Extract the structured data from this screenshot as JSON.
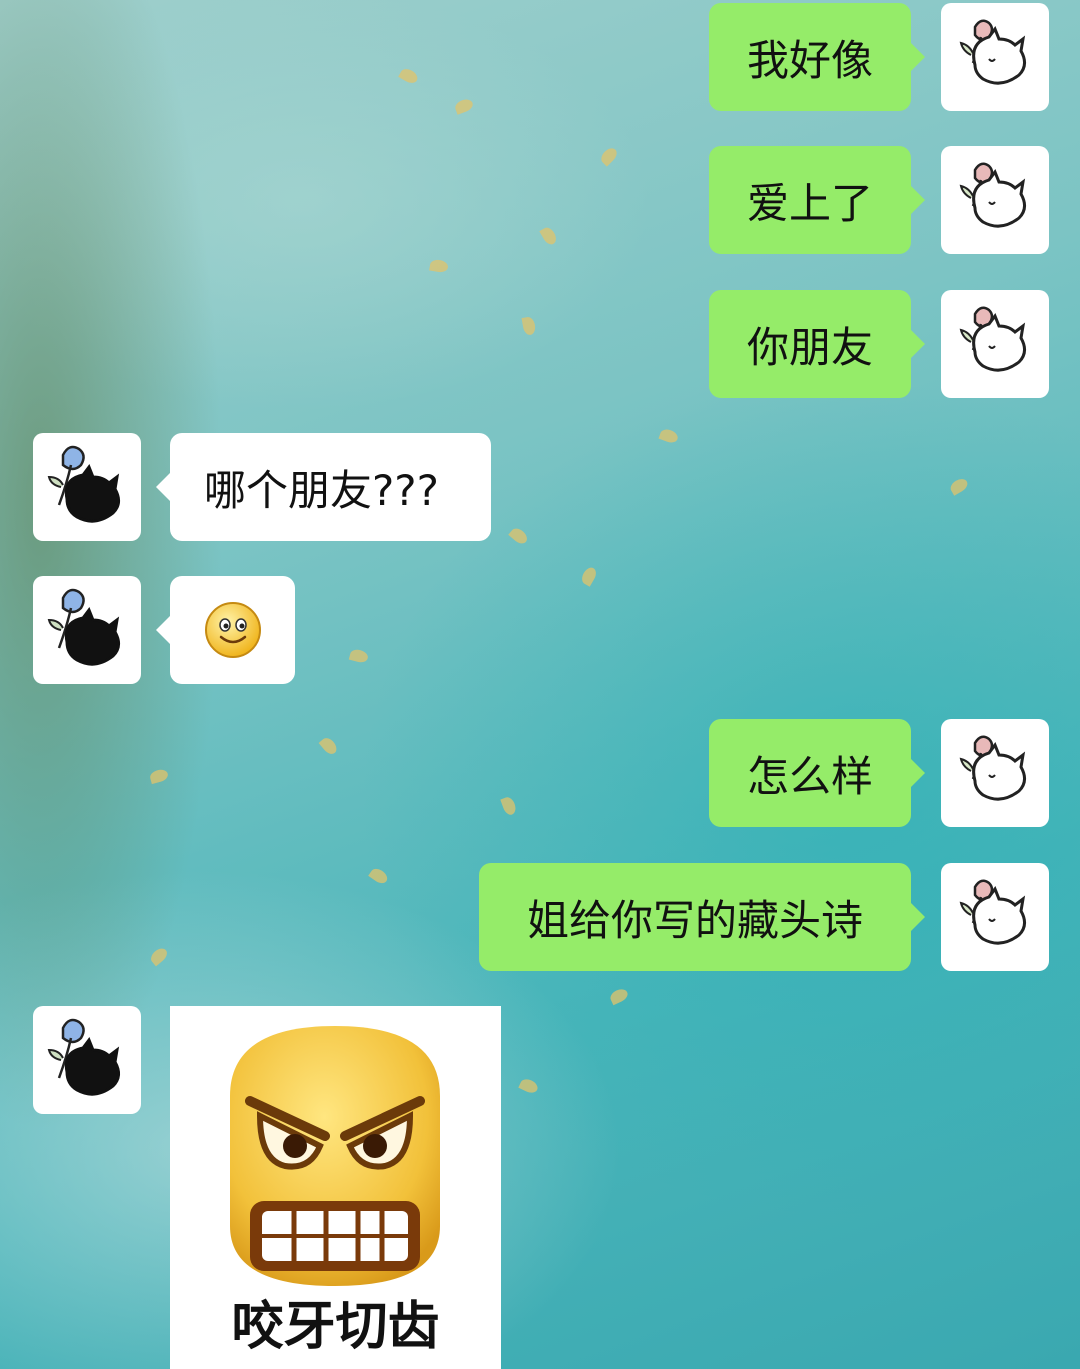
{
  "messages": [
    {
      "id": "m1",
      "side": "out",
      "text": "我好像"
    },
    {
      "id": "m2",
      "side": "out",
      "text": "爱上了"
    },
    {
      "id": "m3",
      "side": "out",
      "text": "你朋友"
    },
    {
      "id": "m4",
      "side": "in",
      "text": "哪个朋友???"
    },
    {
      "id": "m5",
      "side": "in",
      "emoji": "smile-emoji"
    },
    {
      "id": "m6",
      "side": "out",
      "text": "怎么样"
    },
    {
      "id": "m7",
      "side": "out",
      "text": "姐给你写的藏头诗"
    },
    {
      "id": "m8",
      "side": "in",
      "sticker": "angry-face-sticker",
      "caption": "咬牙切齿"
    }
  ],
  "avatars": {
    "self": "pink-rose-cat-avatar",
    "contact": "blue-rose-black-cat-avatar"
  },
  "colors": {
    "outgoing_bubble": "#95ec69",
    "incoming_bubble": "#ffffff",
    "self_rose": "#e8b9b9",
    "contact_rose": "#8fb4e6",
    "sticker_face": "#f2c13a"
  }
}
